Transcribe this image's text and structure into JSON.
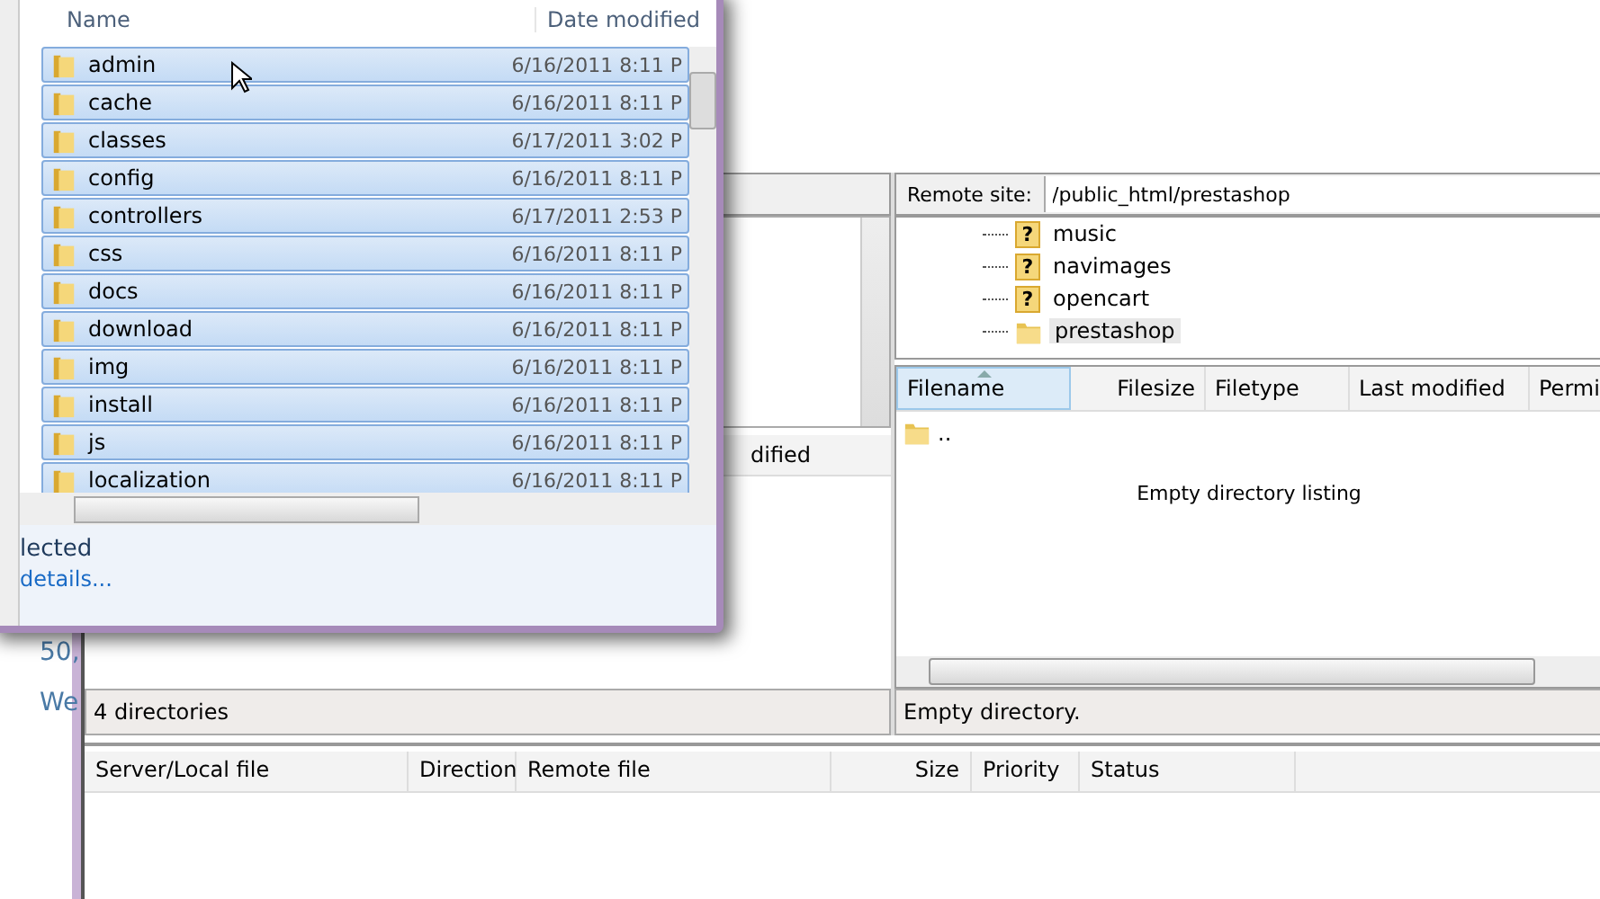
{
  "background_page": {
    "lines": [
      "50,",
      "We"
    ]
  },
  "explorer": {
    "columns": [
      "Name",
      "Date modified"
    ],
    "rows": [
      {
        "name": "admin",
        "date": "6/16/2011 8:11 P",
        "selected": true
      },
      {
        "name": "cache",
        "date": "6/16/2011 8:11 P",
        "selected": true
      },
      {
        "name": "classes",
        "date": "6/17/2011 3:02 P",
        "selected": true
      },
      {
        "name": "config",
        "date": "6/16/2011 8:11 P",
        "selected": true
      },
      {
        "name": "controllers",
        "date": "6/17/2011 2:53 P",
        "selected": true
      },
      {
        "name": "css",
        "date": "6/16/2011 8:11 P",
        "selected": true
      },
      {
        "name": "docs",
        "date": "6/16/2011 8:11 P",
        "selected": true
      },
      {
        "name": "download",
        "date": "6/16/2011 8:11 P",
        "selected": true
      },
      {
        "name": "img",
        "date": "6/16/2011 8:11 P",
        "selected": true
      },
      {
        "name": "install",
        "date": "6/16/2011 8:11 P",
        "selected": true
      },
      {
        "name": "js",
        "date": "6/16/2011 8:11 P",
        "selected": true
      },
      {
        "name": "localization",
        "date": "6/16/2011 8:11 P",
        "selected": true
      }
    ],
    "status": "lected",
    "details_link": "details..."
  },
  "local": {
    "column_fragment": "dified",
    "status": "4 directories"
  },
  "remote": {
    "label": "Remote site:",
    "path": "/public_html/prestashop",
    "tree": [
      {
        "name": "music",
        "kind": "unknown",
        "icon_text": "?",
        "selected": false
      },
      {
        "name": "navimages",
        "kind": "unknown",
        "icon_text": "?",
        "selected": false
      },
      {
        "name": "opencart",
        "kind": "unknown",
        "icon_text": "?",
        "selected": false
      },
      {
        "name": "prestashop",
        "kind": "folder",
        "selected": true
      }
    ],
    "columns": [
      {
        "label": "Filename",
        "sorted": true
      },
      {
        "label": "Filesize",
        "sorted": false
      },
      {
        "label": "Filetype",
        "sorted": false
      },
      {
        "label": "Last modified",
        "sorted": false
      },
      {
        "label": "Permi",
        "sorted": false
      }
    ],
    "rows": [
      {
        "name": ".."
      }
    ],
    "empty_message": "Empty directory listing",
    "status": "Empty directory."
  },
  "queue": {
    "columns": [
      "Server/Local file",
      "Direction",
      "Remote file",
      "Size",
      "Priority",
      "Status"
    ]
  }
}
